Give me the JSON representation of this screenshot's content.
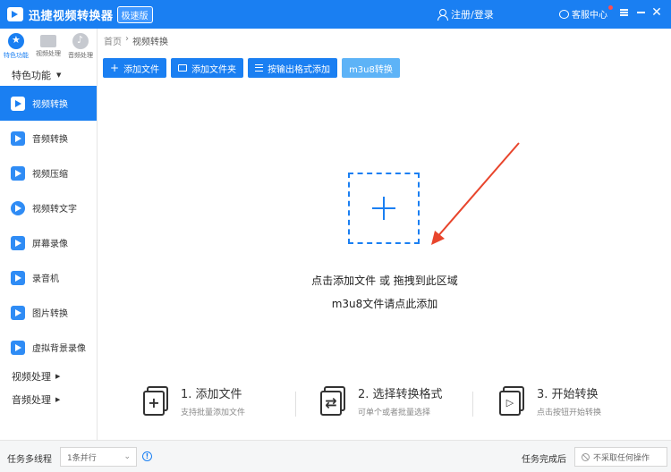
{
  "titlebar": {
    "app_title": "迅捷视频转换器",
    "edition_badge": "极速版",
    "login_label": "注册/登录",
    "service_label": "客服中心",
    "close_glyph": "✕"
  },
  "sidebar": {
    "top_nav": [
      {
        "label": "特色功能",
        "icon": "star-icon",
        "active": true
      },
      {
        "label": "视频处理",
        "icon": "film-icon",
        "active": false
      },
      {
        "label": "音频处理",
        "icon": "music-icon",
        "active": false
      }
    ],
    "section_title": "特色功能",
    "items": [
      {
        "label": "视频转换",
        "active": true
      },
      {
        "label": "音频转换",
        "active": false
      },
      {
        "label": "视频压缩",
        "active": false
      },
      {
        "label": "视频转文字",
        "active": false
      },
      {
        "label": "屏幕录像",
        "active": false
      },
      {
        "label": "录音机",
        "active": false
      },
      {
        "label": "图片转换",
        "active": false
      },
      {
        "label": "虚拟背景录像",
        "active": false
      }
    ],
    "bottom_sections": [
      "视频处理",
      "音频处理"
    ]
  },
  "breadcrumb": {
    "home": "首页",
    "separator": "›",
    "current": "视频转换"
  },
  "toolbar": {
    "add_file": "添加文件",
    "add_folder": "添加文件夹",
    "add_by_format": "按输出格式添加",
    "m3u8": "m3u8转换"
  },
  "dropzone": {
    "hint_line1": "点击添加文件 或 拖拽到此区域",
    "hint_line2": "m3u8文件请点此添加"
  },
  "steps": [
    {
      "title": "1. 添加文件",
      "subtitle": "支持批量添加文件"
    },
    {
      "title": "2. 选择转换格式",
      "subtitle": "可单个或者批量选择"
    },
    {
      "title": "3. 开始转换",
      "subtitle": "点击按钮开始转换"
    }
  ],
  "statusbar": {
    "threads_label": "任务多线程",
    "threads_value": "1条并行",
    "after_label": "任务完成后",
    "after_value": "不采取任何操作"
  },
  "colors": {
    "accent": "#1a7ff2",
    "arrow": "#e8452c"
  }
}
